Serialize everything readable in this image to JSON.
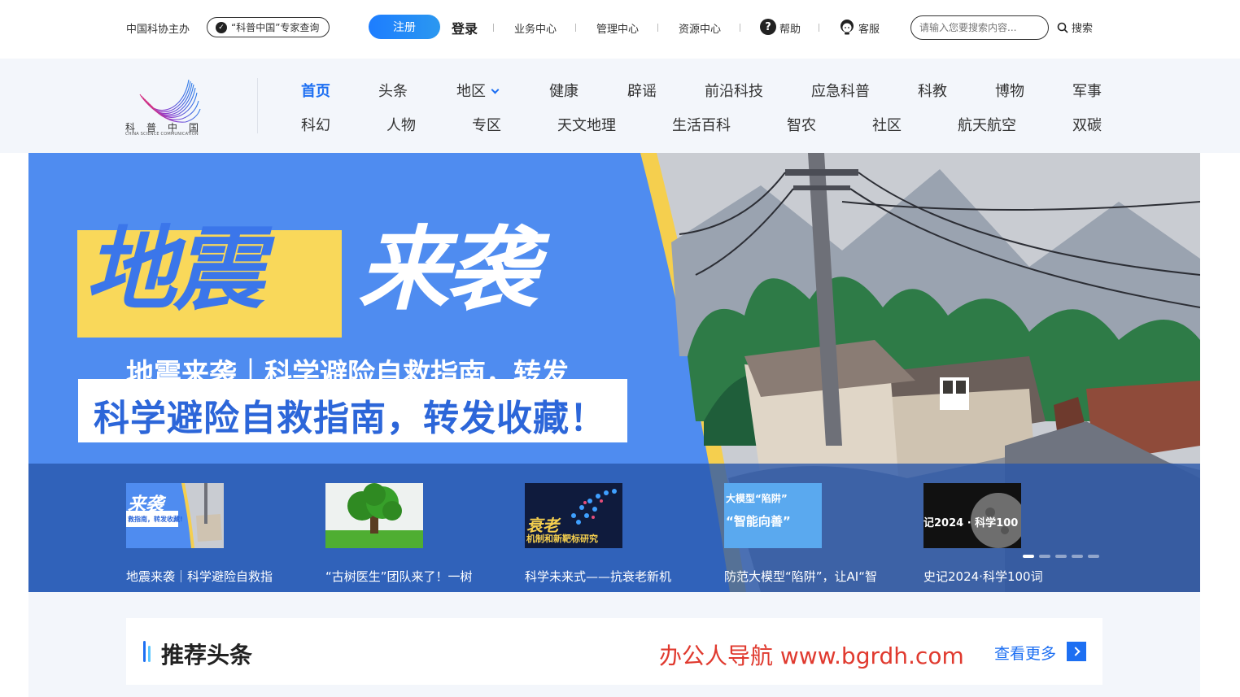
{
  "topbar": {
    "host": "中国科协主办",
    "expert_query": "“科普中国”专家查询",
    "register": "注册",
    "login": "登录",
    "links": [
      "业务中心",
      "管理中心",
      "资源中心"
    ],
    "help": "帮助",
    "service": "客服",
    "search_placeholder": "请输入您要搜索内容...",
    "search_button": "搜索"
  },
  "logo": {
    "cn": "科普中国",
    "en": "CHINA SCIENCE COMMUNICATION"
  },
  "nav": {
    "row1": [
      "首页",
      "头条",
      "地区",
      "健康",
      "辟谣",
      "前沿科技",
      "应急科普",
      "科教",
      "博物",
      "军事"
    ],
    "row2": [
      "科幻",
      "人物",
      "专区",
      "天文地理",
      "生活百科",
      "智农",
      "社区",
      "航天航空",
      "双碳"
    ]
  },
  "banner": {
    "word1": "地震",
    "word2": "来袭",
    "sub_ghost": "地震来袭｜科学避险自救指南，转发",
    "sub": "科学避险自救指南，转发收藏！",
    "thumbs": [
      {
        "caption": "地震来袭｜科学避险自救指",
        "art_main": "来袭",
        "art_sub": "救指南，转发收藏!"
      },
      {
        "caption": "“古树医生”团队来了！一树"
      },
      {
        "caption": "科学未来式——抗衰老新机",
        "art_main": "衰老",
        "art_sub": "机制和新靶标研究"
      },
      {
        "caption": "防范大模型“陷阱”，让AI“智",
        "art_main": "大模型“陷阱”",
        "art_sub": "“智能向善”"
      },
      {
        "caption": "史记2024·科学100词",
        "art_main": "记2024 · 科学100"
      }
    ]
  },
  "recommend": {
    "title": "推荐头条",
    "watermark": "办公人导航 www.bgrdh.com",
    "more": "查看更多"
  },
  "colors": {
    "accent": "#1d6ff2",
    "nav_bg": "#f3f6fb",
    "banner_blue": "#4f8cf0",
    "hero_yellow": "#f9d85a",
    "watermark_red": "#e03a2f"
  }
}
